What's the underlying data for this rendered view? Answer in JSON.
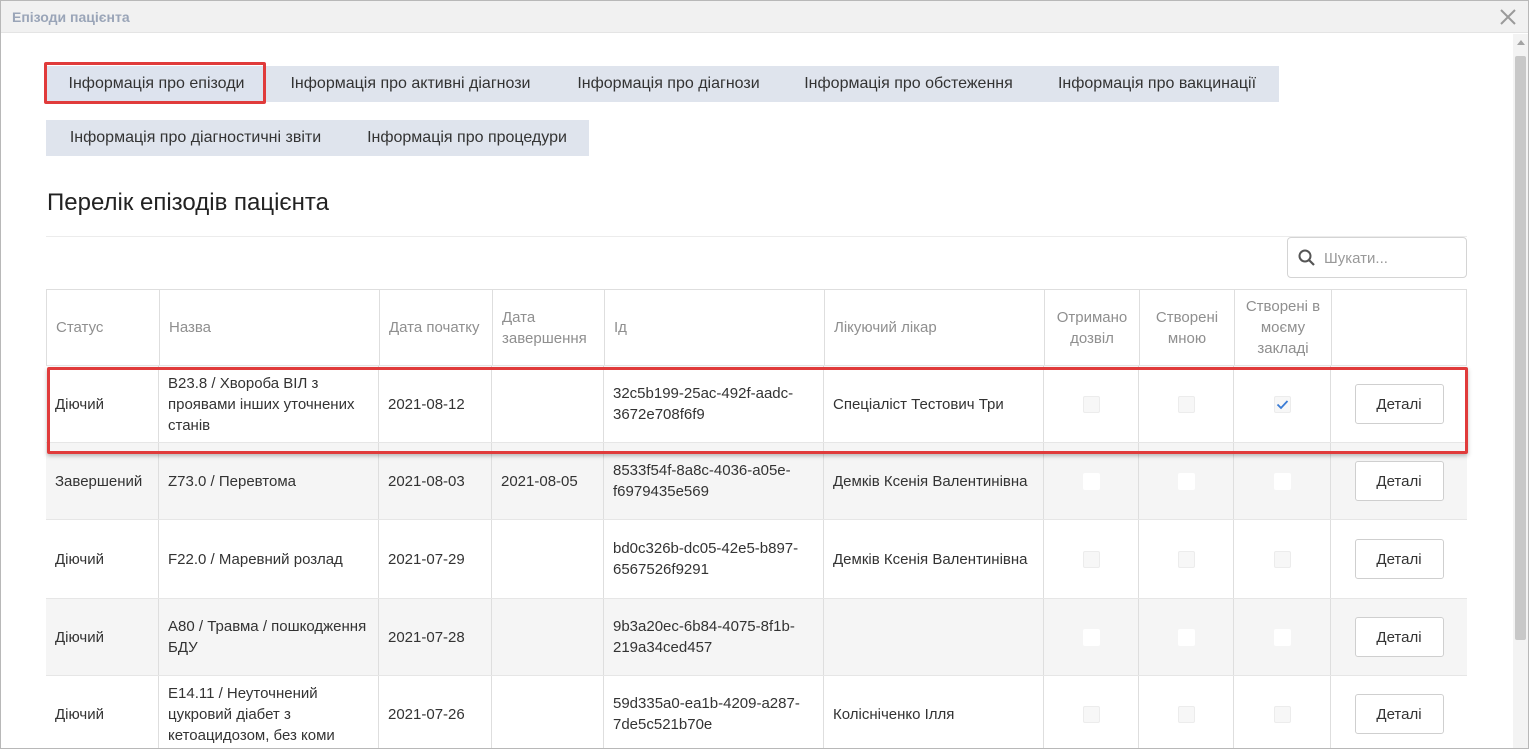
{
  "window": {
    "title": "Епізоди пацієнта"
  },
  "tabs": [
    "Інформація про епізоди",
    "Інформація про активні діагнози",
    "Інформація про діагнози",
    "Інформація про обстеження",
    "Інформація про вакцинації",
    "Інформація про діагностичні звіти",
    "Інформація про процедури"
  ],
  "heading": "Перелік епізодів пацієнта",
  "search": {
    "placeholder": "Шукати..."
  },
  "table": {
    "headers": [
      "Статус",
      "Назва",
      "Дата початку",
      "Дата завершення",
      "Ід",
      "Лікуючий лікар",
      "Отримано дозвіл",
      "Створені мною",
      "Створені в моєму закладі",
      ""
    ],
    "rows": [
      {
        "status": "Діючий",
        "name": "B23.8 / Хвороба ВІЛ з проявами інших уточнених станів",
        "start": "2021-08-12",
        "end": "",
        "id": "32c5b199-25ac-492f-aadc-3672e708f6f9",
        "doctor": "Спеціаліст Тестович Три",
        "permission": false,
        "created_by_me": false,
        "created_in_facility": true,
        "details": "Деталі"
      },
      {
        "status": "Завершений",
        "name": "Z73.0 / Перевтома",
        "start": "2021-08-03",
        "end": "2021-08-05",
        "id": "8533f54f-8a8c-4036-a05e-f6979435e569",
        "doctor": "Демків Ксенія Валентинівна",
        "permission": false,
        "created_by_me": false,
        "created_in_facility": false,
        "details": "Деталі"
      },
      {
        "status": "Діючий",
        "name": "F22.0 / Маревний розлад",
        "start": "2021-07-29",
        "end": "",
        "id": "bd0c326b-dc05-42e5-b897-6567526f9291",
        "doctor": "Демків Ксенія Валентинівна",
        "permission": false,
        "created_by_me": false,
        "created_in_facility": false,
        "details": "Деталі"
      },
      {
        "status": "Діючий",
        "name": "A80 / Травма / пошкодження БДУ",
        "start": "2021-07-28",
        "end": "",
        "id": "9b3a20ec-6b84-4075-8f1b-219a34ced457",
        "doctor": "",
        "permission": false,
        "created_by_me": false,
        "created_in_facility": false,
        "details": "Деталі"
      },
      {
        "status": "Діючий",
        "name": "E14.11 / Неуточнений цукровий діабет з кетоацидозом, без коми",
        "start": "2021-07-26",
        "end": "",
        "id": "59d335a0-ea1b-4209-a287-7de5c521b70e",
        "doctor": "Колісніченко Ілля",
        "permission": false,
        "created_by_me": false,
        "created_in_facility": false,
        "details": "Деталі"
      }
    ]
  },
  "colors": {
    "highlight": "#e03b3b",
    "tab_bg": "#dfe4ed",
    "check": "#3a7bd5"
  }
}
